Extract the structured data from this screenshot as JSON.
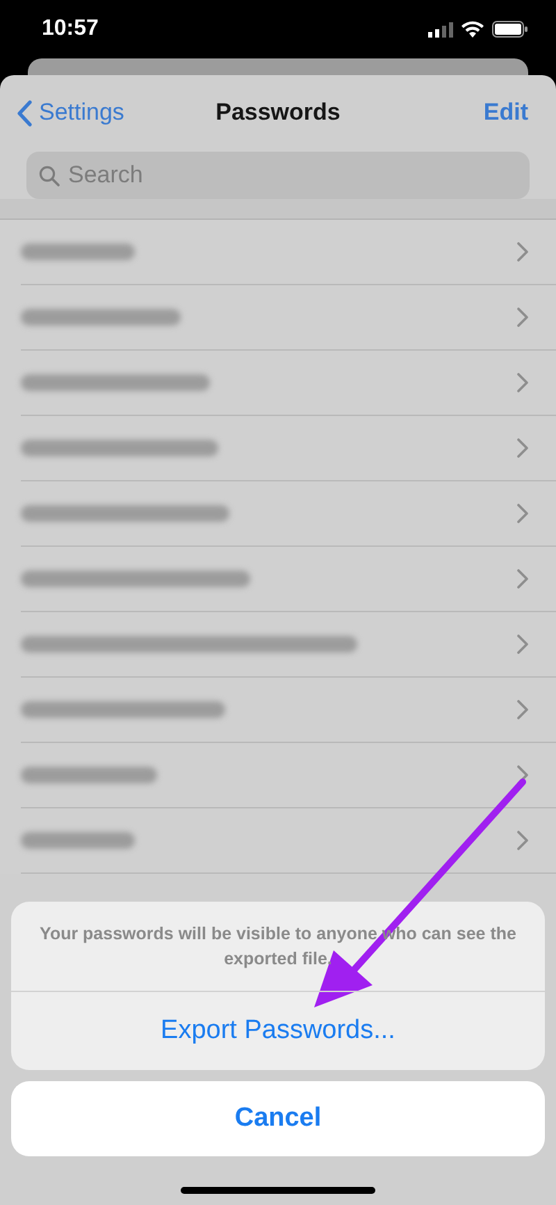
{
  "status_bar": {
    "time": "10:57"
  },
  "nav": {
    "back": "Settings",
    "title": "Passwords",
    "action": "Edit"
  },
  "search": {
    "placeholder": "Search"
  },
  "rows": [
    {
      "kind": "redacted"
    },
    {
      "kind": "redacted"
    },
    {
      "kind": "redacted"
    },
    {
      "kind": "redacted"
    },
    {
      "kind": "redacted"
    },
    {
      "kind": "redacted"
    },
    {
      "kind": "redacted"
    },
    {
      "kind": "redacted"
    },
    {
      "kind": "redacted"
    },
    {
      "kind": "redacted"
    }
  ],
  "action_sheet": {
    "message": "Your passwords will be visible to anyone who can see the exported file.",
    "action": "Export Passwords...",
    "cancel": "Cancel"
  }
}
